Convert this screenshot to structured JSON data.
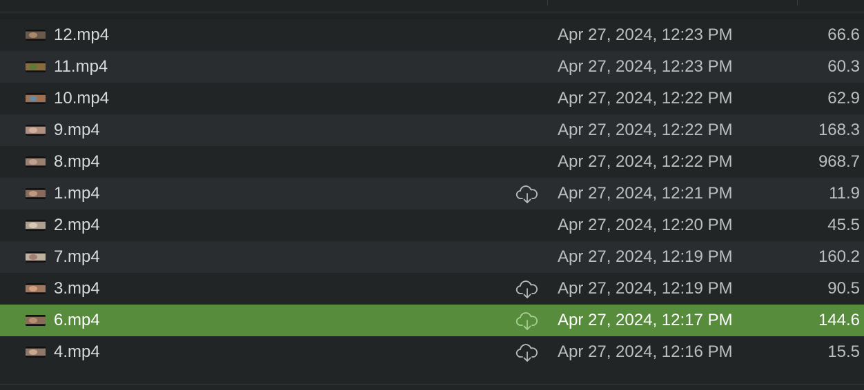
{
  "colors": {
    "selection": "#568c3b",
    "row_odd": "#2a2d2f",
    "row_even": "#222526",
    "text_primary": "#d7d9da",
    "text_secondary": "#bcbfc0"
  },
  "files": [
    {
      "name": "12.mp4",
      "date": "Apr 27, 2024, 12:23 PM",
      "size": "66.6",
      "cloud": false,
      "selected": false,
      "thumb_icon": "video-thumbnail-icon"
    },
    {
      "name": "11.mp4",
      "date": "Apr 27, 2024, 12:23 PM",
      "size": "60.3",
      "cloud": false,
      "selected": false,
      "thumb_icon": "video-thumbnail-icon"
    },
    {
      "name": "10.mp4",
      "date": "Apr 27, 2024, 12:22 PM",
      "size": "62.9",
      "cloud": false,
      "selected": false,
      "thumb_icon": "video-thumbnail-icon"
    },
    {
      "name": "9.mp4",
      "date": "Apr 27, 2024, 12:22 PM",
      "size": "168.3",
      "cloud": false,
      "selected": false,
      "thumb_icon": "video-thumbnail-icon"
    },
    {
      "name": "8.mp4",
      "date": "Apr 27, 2024, 12:22 PM",
      "size": "968.7",
      "cloud": false,
      "selected": false,
      "thumb_icon": "video-thumbnail-icon"
    },
    {
      "name": "1.mp4",
      "date": "Apr 27, 2024, 12:21 PM",
      "size": "11.9",
      "cloud": true,
      "selected": false,
      "thumb_icon": "video-thumbnail-icon"
    },
    {
      "name": "2.mp4",
      "date": "Apr 27, 2024, 12:20 PM",
      "size": "45.5",
      "cloud": false,
      "selected": false,
      "thumb_icon": "video-thumbnail-icon"
    },
    {
      "name": "7.mp4",
      "date": "Apr 27, 2024, 12:19 PM",
      "size": "160.2",
      "cloud": false,
      "selected": false,
      "thumb_icon": "video-thumbnail-icon"
    },
    {
      "name": "3.mp4",
      "date": "Apr 27, 2024, 12:19 PM",
      "size": "90.5",
      "cloud": true,
      "selected": false,
      "thumb_icon": "video-thumbnail-icon"
    },
    {
      "name": "6.mp4",
      "date": "Apr 27, 2024, 12:17 PM",
      "size": "144.6",
      "cloud": true,
      "selected": true,
      "thumb_icon": "video-thumbnail-icon"
    },
    {
      "name": "4.mp4",
      "date": "Apr 27, 2024, 12:16 PM",
      "size": "15.5",
      "cloud": true,
      "selected": false,
      "thumb_icon": "video-thumbnail-icon"
    }
  ],
  "cloud_icon": "cloud-download-icon"
}
